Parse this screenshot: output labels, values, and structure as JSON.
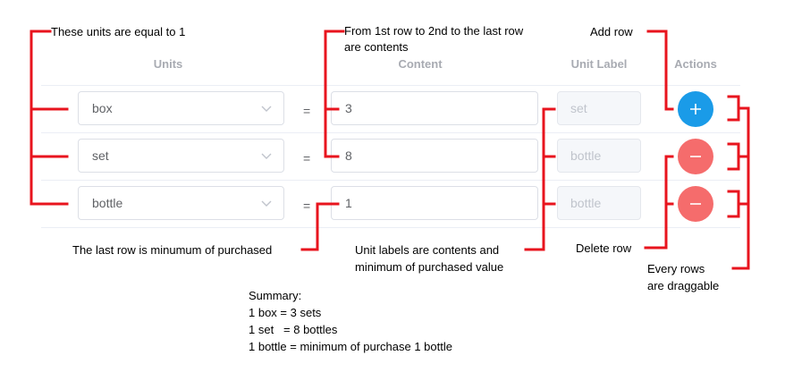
{
  "table": {
    "headers": {
      "units": "Units",
      "content": "Content",
      "unit_label": "Unit Label",
      "actions": "Actions"
    },
    "equals": "=",
    "rows": [
      {
        "unit": "box",
        "content": "3",
        "unit_label": "set",
        "action": "add"
      },
      {
        "unit": "set",
        "content": "8",
        "unit_label": "bottle",
        "action": "delete"
      },
      {
        "unit": "bottle",
        "content": "1",
        "unit_label": "bottle",
        "action": "delete"
      }
    ]
  },
  "annotations": {
    "units_equal": "These units are equal to 1",
    "contents_line1": "From 1st row to 2nd to the last row",
    "contents_line2": "are contents",
    "add_row": "Add row",
    "last_row": "The last row is minumum of purchased",
    "unit_labels_line1": "Unit labels are contents and",
    "unit_labels_line2": "minimum of purchased value",
    "delete_row": "Delete row",
    "draggable_line1": "Every rows",
    "draggable_line2": "are draggable",
    "summary": [
      "Summary:",
      "1 box = 3 sets",
      "1 set   = 8 bottles",
      "1 bottle = minimum of purchase 1 bottle"
    ]
  },
  "colors": {
    "add_button": "#1a9be8",
    "delete_button": "#f56c6c",
    "annotation_line": "#e8141e"
  },
  "icons": {
    "select_arrow": "chevron-down-icon",
    "add": "plus-icon",
    "delete": "minus-icon"
  }
}
